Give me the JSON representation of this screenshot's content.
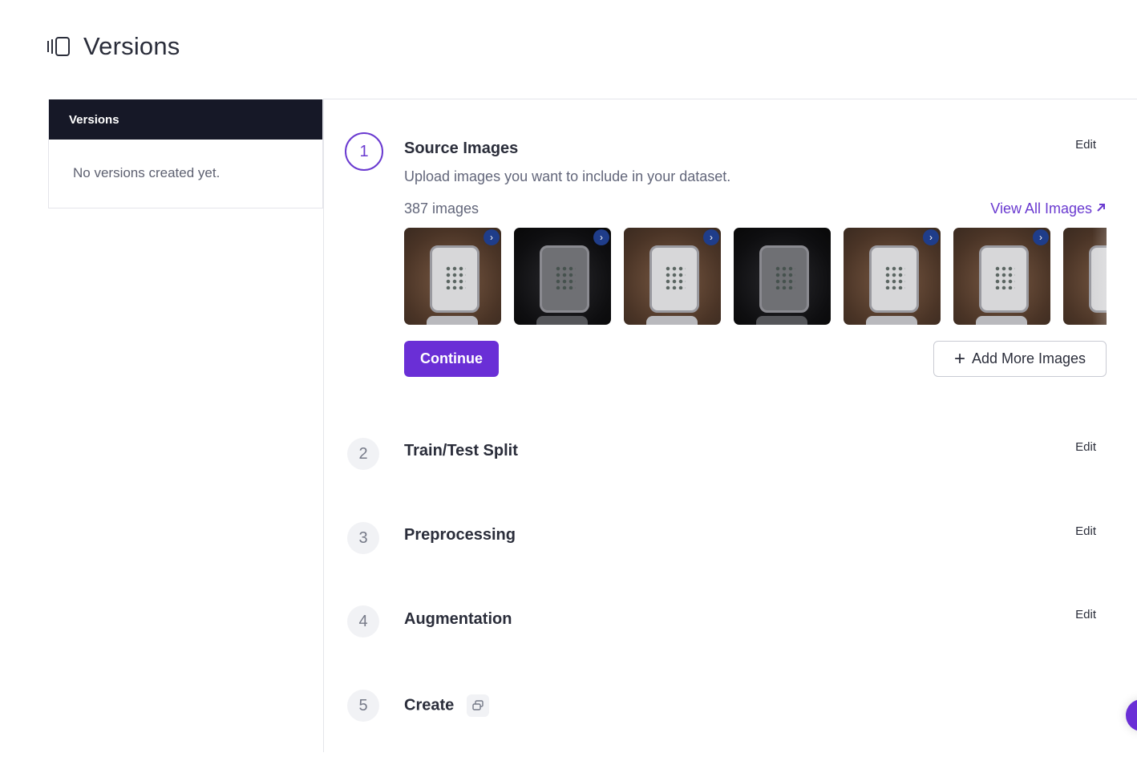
{
  "header": {
    "title": "Versions",
    "icon": "sidebar-toggle-icon"
  },
  "sidebar": {
    "heading": "Versions",
    "empty_text": "No versions created yet."
  },
  "steps": [
    {
      "number": "1",
      "title": "Source Images",
      "edit": "Edit",
      "description": "Upload images you want to include in your dataset.",
      "image_count": "387 images",
      "view_all": "View All Images",
      "continue": "Continue",
      "add_more": "Add More Images"
    },
    {
      "number": "2",
      "title": "Train/Test Split",
      "edit": "Edit"
    },
    {
      "number": "3",
      "title": "Preprocessing",
      "edit": "Edit"
    },
    {
      "number": "4",
      "title": "Augmentation",
      "edit": "Edit"
    },
    {
      "number": "5",
      "title": "Create",
      "icon": "stack-icon"
    }
  ],
  "colors": {
    "accent": "#6a2fd6",
    "sidebar_header": "#161827"
  }
}
